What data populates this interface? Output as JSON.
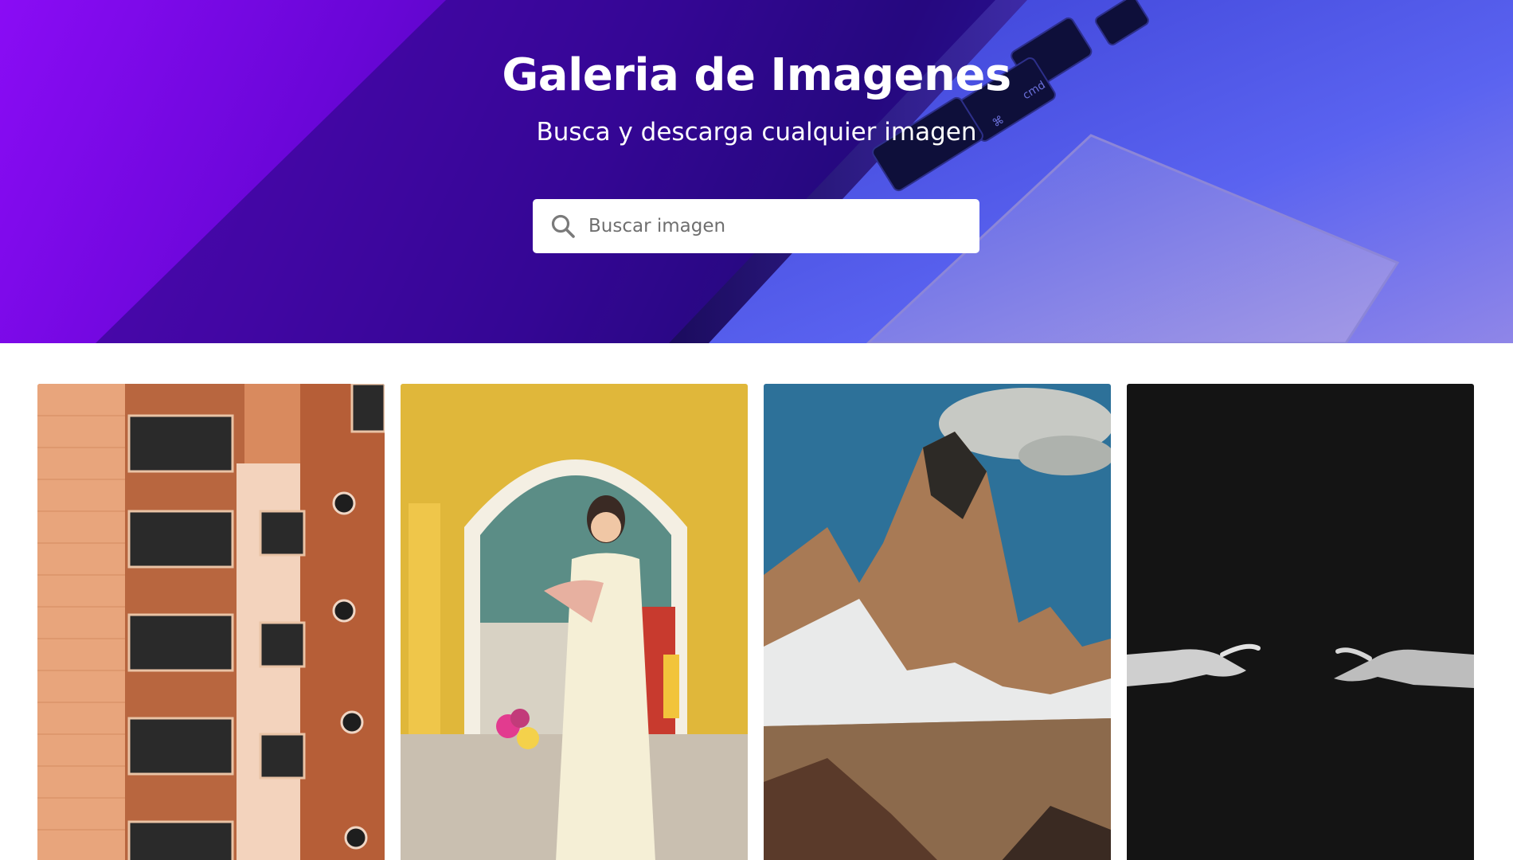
{
  "hero": {
    "title": "Galeria de Imagenes",
    "subtitle": "Busca y descarga cualquier imagen",
    "background_colors": [
      "#8a0cf5",
      "#2a0a86",
      "#4f56ec"
    ]
  },
  "search": {
    "icon": "search-icon",
    "placeholder": "Buscar imagen",
    "value": ""
  },
  "gallery": {
    "images": [
      {
        "subject": "brick-apartment-building",
        "dominant_color": "#c8784e"
      },
      {
        "subject": "woman-in-yellow-archway",
        "dominant_color": "#e0b73a"
      },
      {
        "subject": "snowy-mountain-peak",
        "dominant_color": "#2f6f96"
      },
      {
        "subject": "reaching-hands-dark",
        "dominant_color": "#151515"
      }
    ]
  }
}
